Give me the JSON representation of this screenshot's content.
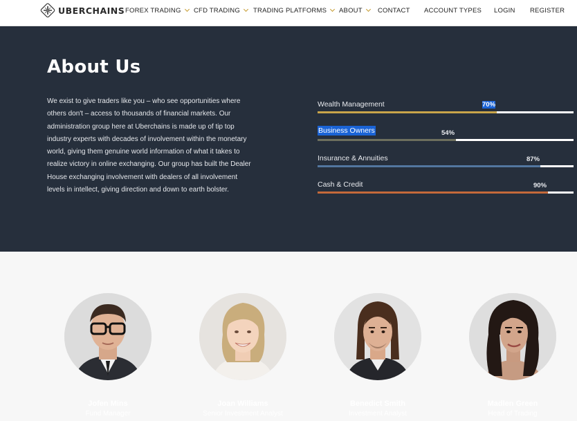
{
  "brand": {
    "name": "UBERCHAINS"
  },
  "nav": {
    "items": [
      {
        "label": "FOREX TRADING",
        "has_dropdown": true
      },
      {
        "label": "CFD TRADING",
        "has_dropdown": true
      },
      {
        "label": "TRADING PLATFORMS",
        "has_dropdown": true
      },
      {
        "label": "ABOUT",
        "has_dropdown": true
      },
      {
        "label": "CONTACT",
        "has_dropdown": false
      },
      {
        "label": "ACCOUNT TYPES",
        "has_dropdown": false
      },
      {
        "label": "LOGIN",
        "has_dropdown": false
      },
      {
        "label": "REGISTER",
        "has_dropdown": false
      }
    ]
  },
  "about": {
    "title": "About Us",
    "paragraph": "We exist to give traders like you – who see opportunities where others don't – access to thousands of financial markets. Our administration group here at Uberchains is made up of tip top industry experts with decades of involvement within the monetary world, giving them genuine world information of what it takes to realize victory in online exchanging. Our group has built the Dealer House exchanging involvement with dealers of all involvement levels in intellect, giving direction and down to earth bolster."
  },
  "skills": [
    {
      "label": "Wealth Management",
      "percent_text": "70%",
      "value": 70,
      "color": "#c9a54a"
    },
    {
      "label": "Business Owners",
      "percent_text": "54%",
      "value": 54,
      "color": "#6e705e"
    },
    {
      "label": "Insurance & Annuities",
      "percent_text": "87%",
      "value": 87,
      "color": "#5377a0"
    },
    {
      "label": "Cash & Credit",
      "percent_text": "90%",
      "value": 90,
      "color": "#c4693a"
    }
  ],
  "team": [
    {
      "name": "Jofen Mins",
      "role": "Fund Manager"
    },
    {
      "name": "Joan Williams",
      "role": "Senior Investment Analyst"
    },
    {
      "name": "Benedict Smith",
      "role": "Investment Analyst"
    },
    {
      "name": "Madlen Green",
      "role": "Head of Trading"
    }
  ],
  "colors": {
    "hero_bg": "#262f3c",
    "accent_gold": "#c59a2d",
    "selection": "#1a63d6"
  }
}
